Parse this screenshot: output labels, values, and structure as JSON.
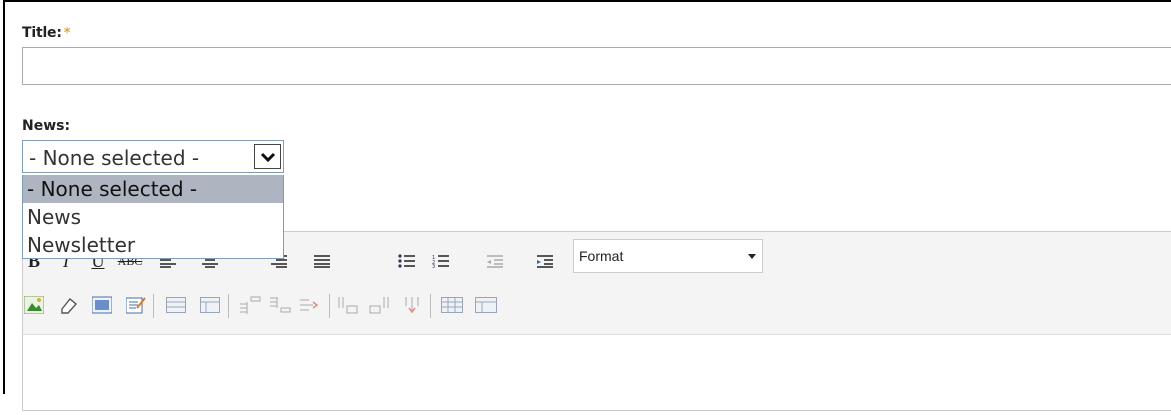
{
  "form": {
    "title_label": "Title:",
    "title_required_mark": "*",
    "title_value": "",
    "news_label": "News:",
    "news_selected": "- None selected -",
    "news_options": [
      "- None selected -",
      "News",
      "Newsletter"
    ]
  },
  "editor": {
    "format_label": "Format",
    "row1_icons": [
      "bold-icon",
      "italic-icon",
      "underline-icon",
      "strikethrough-icon",
      "align-left-icon",
      "align-center-icon",
      "align-right-icon",
      "align-justify-icon",
      "bullet-list-icon",
      "numbered-list-icon",
      "outdent-icon",
      "indent-icon"
    ],
    "row2_icons": [
      "image-icon",
      "cleanup-icon",
      "code-icon",
      "edit-icon",
      "table-row-props-icon",
      "table-cell-props-icon",
      "insert-row-before-icon",
      "insert-row-after-icon",
      "delete-row-icon",
      "insert-col-before-icon",
      "insert-col-after-icon",
      "delete-col-icon",
      "split-cells-icon",
      "merge-cells-icon"
    ]
  },
  "colors": {
    "required_mark": "#e8a33a",
    "dropdown_selected_bg": "#aeb4c0",
    "select_border": "#7f9db9"
  }
}
